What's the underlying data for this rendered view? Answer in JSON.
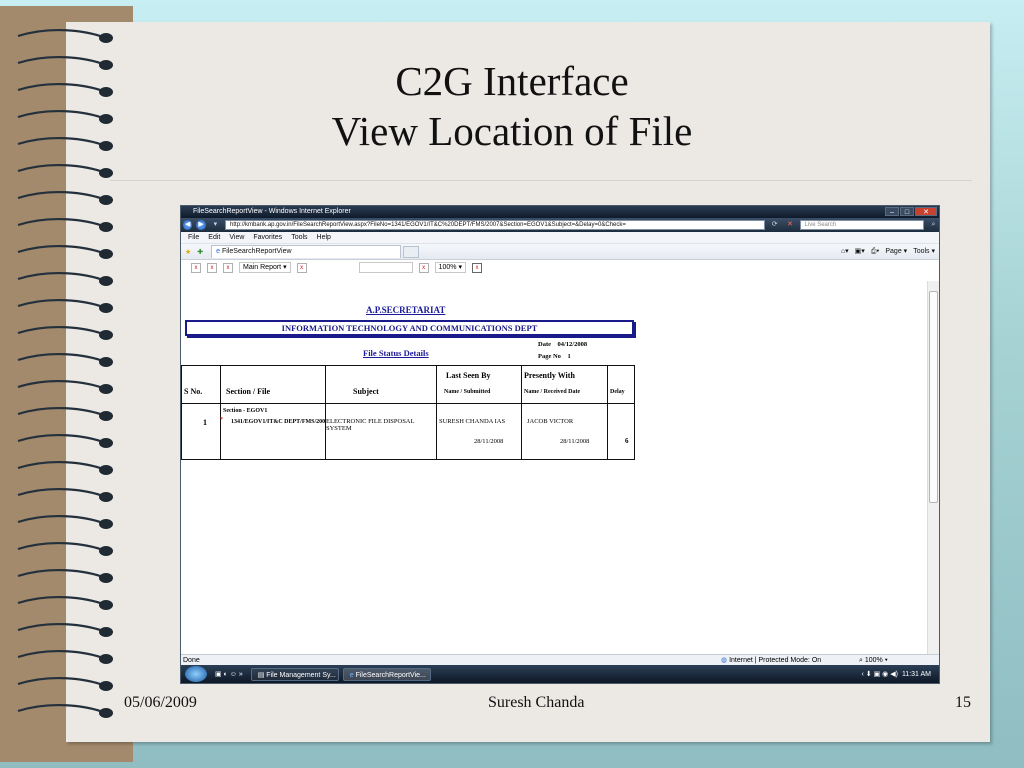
{
  "slide": {
    "title_line1": "C2G Interface",
    "title_line2": "View Location of File",
    "footer_date": "05/06/2009",
    "footer_author": "Suresh Chanda",
    "slide_number": "15"
  },
  "browser": {
    "window_title": "FileSearchReportView - Windows Internet Explorer",
    "address": "http://kmbank.ap.gov.in/FileSearchReportView.aspx?FileNo=1341/EGOV1/IT&C%20DEPT/FMS/2007&Section=EGOV1&Subject=&Delay=0&Check=",
    "search_placeholder": "Live Search",
    "menu": [
      "File",
      "Edit",
      "View",
      "Favorites",
      "Tools",
      "Help"
    ],
    "tab_title": "FileSearchReportView",
    "cmd_page": "Page",
    "cmd_tools": "Tools",
    "status_left": "Done",
    "status_zone": "Internet | Protected Mode: On",
    "status_zoom": "100%",
    "taskbar_items": [
      "File Management Sy...",
      "FileSearchReportVie..."
    ],
    "clock": "11:31 AM"
  },
  "report_toolbar": {
    "main_report": "Main Report",
    "zoom": "100%"
  },
  "report": {
    "heading": "A.P.SECRETARIAT",
    "department": "INFORMATION TECHNOLOGY AND COMMUNICATIONS DEPT",
    "title": "File Status Details",
    "date_label": "Date",
    "date_value": "04/12/2008",
    "page_label": "Page No",
    "page_value": "1",
    "columns": {
      "sno": "S No.",
      "section_file": "Section / File",
      "subject": "Subject",
      "last_seen": "Last Seen By",
      "last_seen_sub": "Name / Submitted",
      "presently": "Presently With",
      "presently_sub": "Name / Received Date",
      "delay": "Delay"
    },
    "row": {
      "sno": "1",
      "section": "Section - EGOV1",
      "file": "1341/EGOV1/IT&C DEPT/FMS/2007",
      "subject": "ELECTRONIC FILE DISPOSAL SYSTEM",
      "last_seen_name": "SURESH CHANDA IAS",
      "last_seen_date": "28/11/2008",
      "presently_name": "JACOB VICTOR",
      "presently_date": "28/11/2008",
      "delay": "6"
    }
  }
}
